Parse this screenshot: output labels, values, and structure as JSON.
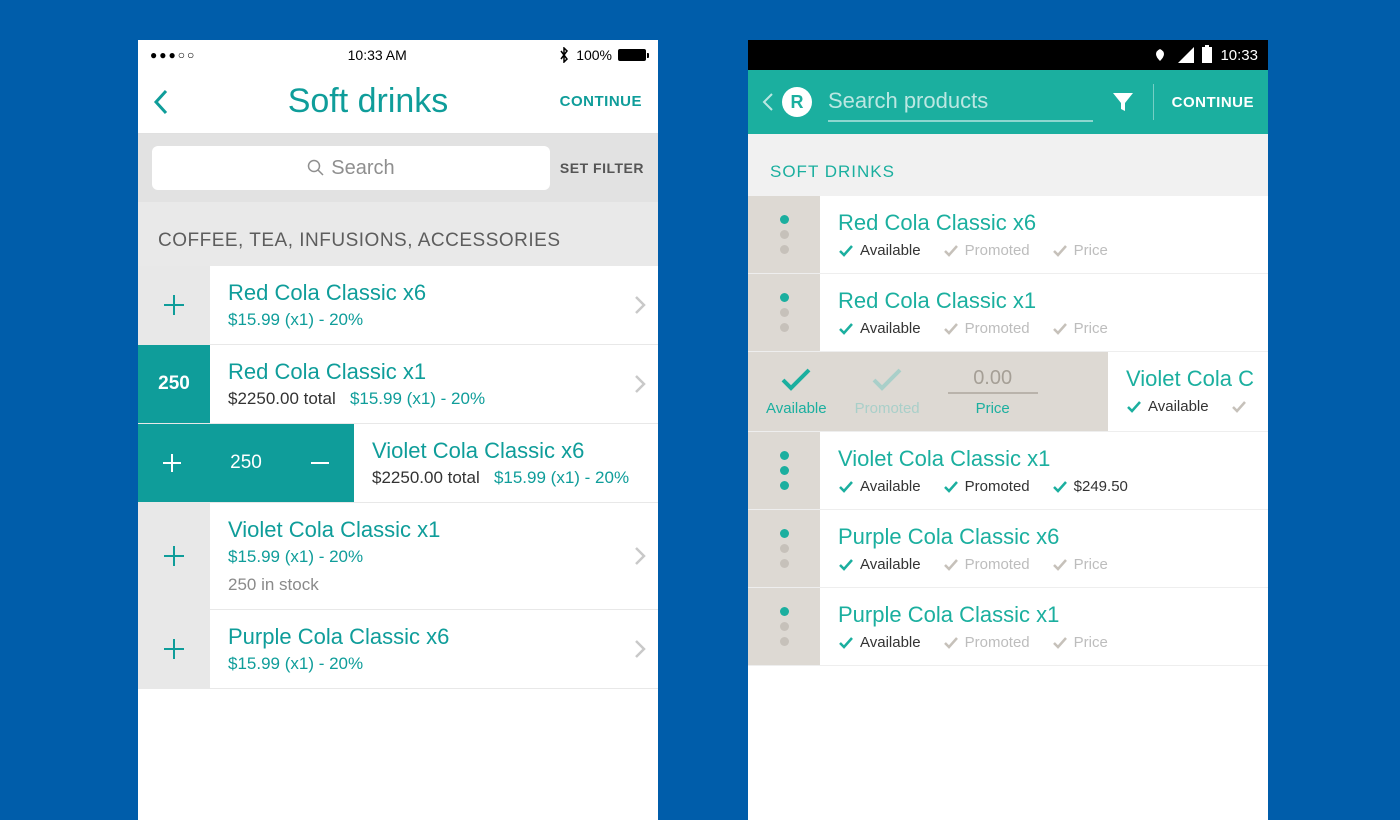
{
  "ios": {
    "status": {
      "time": "10:33 AM",
      "battery": "100%"
    },
    "nav": {
      "title": "Soft drinks",
      "continue": "CONTINUE"
    },
    "search": {
      "placeholder": "Search",
      "filter": "SET FILTER"
    },
    "section": "COFFEE, TEA, INFUSIONS, ACCESSORIES",
    "items": [
      {
        "name": "Red Cola Classic x6",
        "sub": "$15.99 (x1) - 20%"
      },
      {
        "name": "Red Cola Classic x1",
        "qty": "250",
        "total": "$2250.00 total",
        "price": "$15.99 (x1) - 20%"
      },
      {
        "name": "Violet Cola Classic x6",
        "qty": "250",
        "total": "$2250.00 total",
        "price": "$15.99 (x1) - 20%"
      },
      {
        "name": "Violet Cola Classic x1",
        "sub": "$15.99 (x1) - 20%",
        "stock": "250 in stock"
      },
      {
        "name": "Purple Cola Classic x6",
        "sub": "$15.99 (x1) - 20%"
      }
    ]
  },
  "android": {
    "status": {
      "time": "10:33"
    },
    "nav": {
      "search_placeholder": "Search products",
      "continue": "CONTINUE"
    },
    "section": "SOFT DRINKS",
    "tags": {
      "available": "Available",
      "promoted": "Promoted",
      "price": "Price"
    },
    "expanded": {
      "available": "Available",
      "promoted": "Promoted",
      "price_label": "Price",
      "price_value": "0.00",
      "rightName": "Violet Cola C",
      "rightTag": "Available"
    },
    "items": [
      {
        "name": "Red Cola Classic x6",
        "dots": [
          true,
          false,
          false
        ],
        "avail": true,
        "promo": false,
        "priceOn": false,
        "priceText": "Price"
      },
      {
        "name": "Red Cola Classic x1",
        "dots": [
          true,
          false,
          false
        ],
        "avail": true,
        "promo": false,
        "priceOn": false,
        "priceText": "Price"
      },
      {
        "name": "Violet Cola Classic x1",
        "dots": [
          true,
          true,
          true
        ],
        "avail": true,
        "promo": true,
        "priceOn": true,
        "priceText": "$249.50"
      },
      {
        "name": "Purple Cola Classic x6",
        "dots": [
          true,
          false,
          false
        ],
        "avail": true,
        "promo": false,
        "priceOn": false,
        "priceText": "Price"
      },
      {
        "name": "Purple Cola Classic x1",
        "dots": [
          true,
          false,
          false
        ],
        "avail": true,
        "promo": false,
        "priceOn": false,
        "priceText": "Price"
      }
    ]
  }
}
